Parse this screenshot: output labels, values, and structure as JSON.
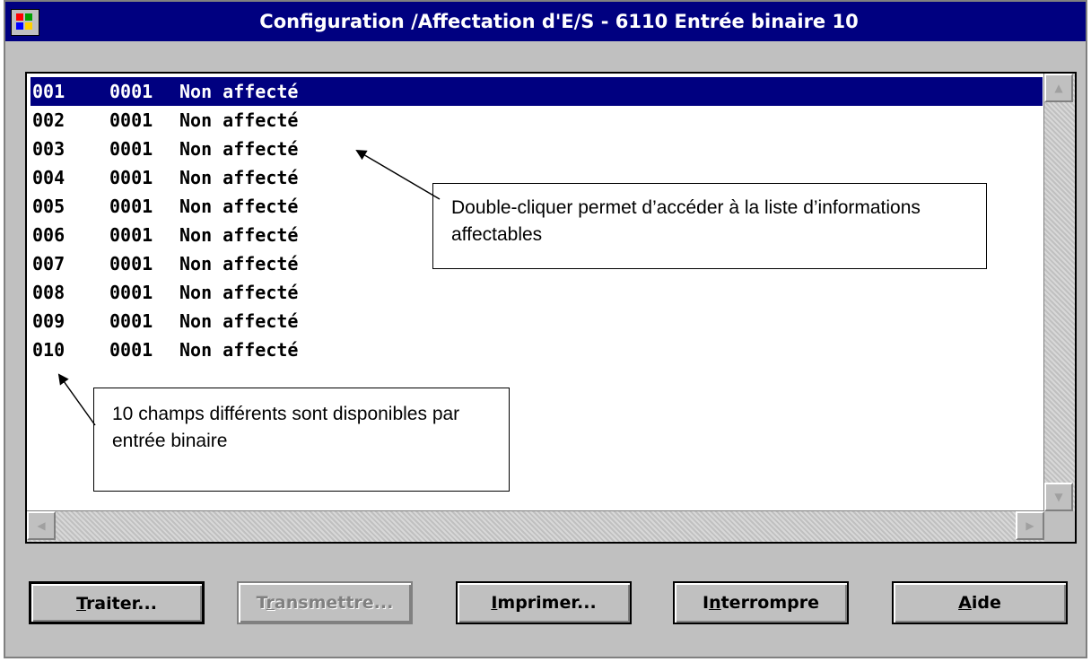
{
  "window": {
    "title": "Configuration /Affectation d'E/S - 6110 Entrée binaire 10"
  },
  "list": {
    "rows": [
      {
        "index": "001",
        "code": "0001",
        "label": "Non affecté",
        "selected": true
      },
      {
        "index": "002",
        "code": "0001",
        "label": "Non affecté"
      },
      {
        "index": "003",
        "code": "0001",
        "label": "Non affecté"
      },
      {
        "index": "004",
        "code": "0001",
        "label": "Non affecté"
      },
      {
        "index": "005",
        "code": "0001",
        "label": "Non affecté"
      },
      {
        "index": "006",
        "code": "0001",
        "label": "Non affecté"
      },
      {
        "index": "007",
        "code": "0001",
        "label": "Non affecté"
      },
      {
        "index": "008",
        "code": "0001",
        "label": "Non affecté"
      },
      {
        "index": "009",
        "code": "0001",
        "label": "Non affecté"
      },
      {
        "index": "010",
        "code": "0001",
        "label": "Non affecté"
      }
    ]
  },
  "annotations": {
    "double_click_note": "Double-cliquer permet d’accéder à la liste d’informations affectables",
    "fields_note": "10 champs différents sont disponibles par entrée binaire"
  },
  "buttons": {
    "traiter": {
      "first": "T",
      "rest": "raiter..."
    },
    "transmettre": {
      "first": "T",
      "second": "r",
      "rest": "ansmettre..."
    },
    "imprimer": {
      "first": "I",
      "rest": "mprimer..."
    },
    "interrompre": {
      "first": "I",
      "second": "n",
      "rest": "terrompre"
    },
    "aide": {
      "first": "A",
      "rest": "ide"
    }
  },
  "colors": {
    "selection": "#000080",
    "face": "#c0c0c0",
    "title_bar": "#000080"
  }
}
